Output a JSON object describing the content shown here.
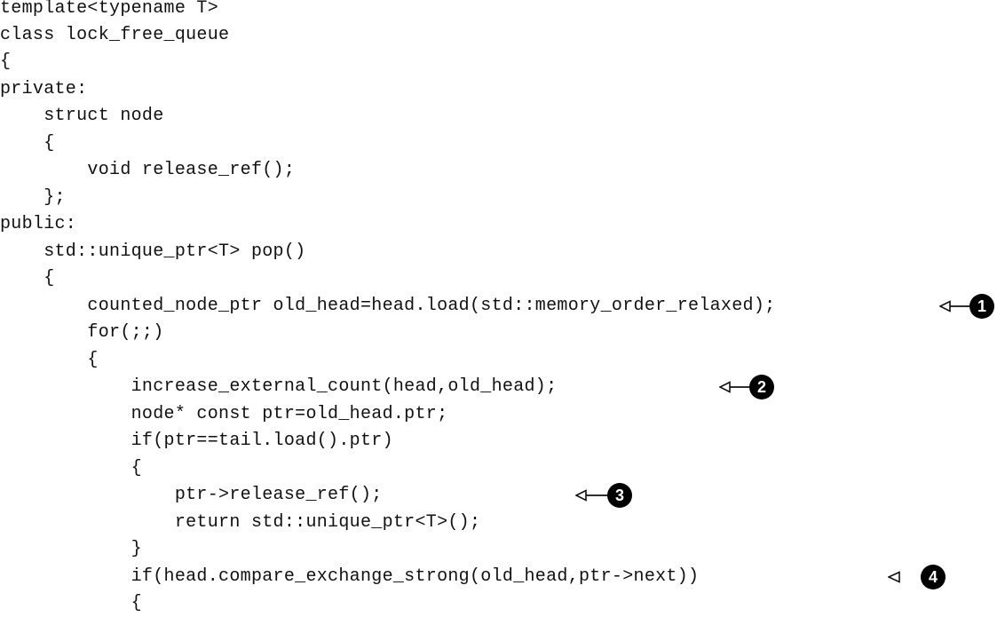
{
  "code_lines": [
    "template<typename T>",
    "class lock_free_queue",
    "{",
    "private:",
    "    struct node",
    "    {",
    "        void release_ref();",
    "    };",
    "public:",
    "    std::unique_ptr<T> pop()",
    "    {",
    "        counted_node_ptr old_head=head.load(std::memory_order_relaxed);",
    "        for(;;)",
    "        {",
    "            increase_external_count(head,old_head);",
    "            node* const ptr=old_head.ptr;",
    "            if(ptr==tail.load().ptr)",
    "            {",
    "                ptr->release_ref();",
    "                return std::unique_ptr<T>();",
    "            }",
    "            if(head.compare_exchange_strong(old_head,ptr->next))",
    "            {"
  ],
  "callouts": [
    {
      "number": "1",
      "line": 11
    },
    {
      "number": "2",
      "line": 14
    },
    {
      "number": "3",
      "line": 18
    },
    {
      "number": "4",
      "line": 21
    }
  ]
}
